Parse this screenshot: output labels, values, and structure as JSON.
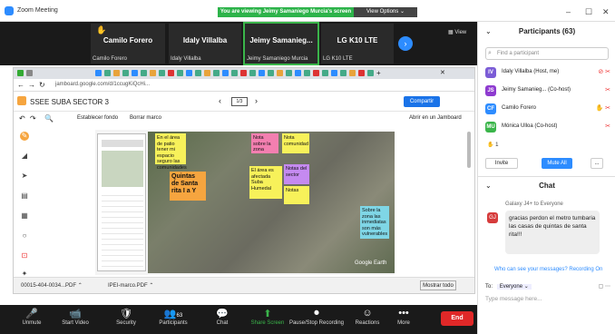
{
  "window": {
    "title": "Zoom Meeting",
    "viewing_banner": "You are viewing Jeimy Samaniego Murcia's screen",
    "view_options": "View Options ⌄"
  },
  "strip": {
    "view_label": "▦ View",
    "tiles": [
      {
        "name": "Camilo Forero",
        "sub": "Camilo Forero"
      },
      {
        "name": "Idaly Villalba",
        "sub": "Idaly Villalba"
      },
      {
        "name": "Jeimy Samanieg...",
        "sub": "Jeimy Samaniego Murcia"
      },
      {
        "name": "LG K10 LTE",
        "sub": "LG K10 LTE"
      }
    ]
  },
  "browser": {
    "url": "jamboard.google.com/d/1ccugKiQcHi...",
    "jam_title": "SSEE SUBA SECTOR 3",
    "page_indicator": "1/3",
    "share_label": "Compartir",
    "tool_labels": {
      "set_bg": "Establecer fondo",
      "clear": "Borrar marco",
      "open": "Abrir en un Jamboard"
    },
    "notes": [
      {
        "text": "En el área de patio tener mi espacio seguro las comunidades",
        "color": "#f7f15a"
      },
      {
        "text": "Quintas de Santa rita I a Y",
        "color": "#f6a53f"
      },
      {
        "text": "Nota sobre la zona",
        "color": "#f37fb0"
      },
      {
        "text": "Nota comunidad",
        "color": "#f7f15a"
      },
      {
        "text": "El área es afectada Suba Humedal",
        "color": "#f7f15a"
      },
      {
        "text": "Notas del sector",
        "color": "#c58af0"
      },
      {
        "text": "Notas",
        "color": "#f7f15a"
      },
      {
        "text": "Sobre la zona las inmediatas son más vulnerables",
        "color": "#7fd6e6"
      }
    ],
    "map_label": "Google Earth",
    "downloads": [
      "00015-404-0034...PDF ⌃",
      "IPEI-marco.PDF ⌃"
    ],
    "show_all": "Mostrar todo"
  },
  "toolbar": {
    "items": [
      {
        "icon": "🎤",
        "label": "Unmute"
      },
      {
        "icon": "📹",
        "label": "Start Video"
      },
      {
        "icon": "🛡",
        "label": "Security"
      },
      {
        "icon": "👥",
        "label": "Participants"
      },
      {
        "icon": "💬",
        "label": "Chat"
      },
      {
        "icon": "⬆",
        "label": "Share Screen"
      },
      {
        "icon": "⏺",
        "label": "Pause/Stop Recording"
      },
      {
        "icon": "☺",
        "label": "Reactions"
      },
      {
        "icon": "•••",
        "label": "More"
      }
    ],
    "participant_count": "63",
    "end_label": "End"
  },
  "panel": {
    "title": "Participants (63)",
    "search_placeholder": "Find a participant",
    "participants": [
      {
        "initials": "IV",
        "name": "Idaly Villalba (Host, me)",
        "color": "#7b5cd6"
      },
      {
        "initials": "JS",
        "name": "Jeimy Samanieg... (Co-host)",
        "color": "#8e3bd0"
      },
      {
        "initials": "CF",
        "name": "Camilo Forero",
        "color": "#2D8CFF"
      },
      {
        "initials": "MU",
        "name": "Mónica Ulloa (Co-host)",
        "color": "#3ab54a"
      }
    ],
    "raised_hands": "✋ 1",
    "invite": "Invite",
    "mute_all": "Mute All",
    "more": "...",
    "chat_title": "Chat",
    "chat_from": "Galaxy J4+ to Everyone",
    "chat_initials": "GJ",
    "chat_message": "gracias perdon el metro tumbaria las casas de quintas de santa rita!!!",
    "who_can_see": "Who can see your messages? Recording On",
    "to_label": "To:",
    "to_value": "Everyone ⌄",
    "message_placeholder": "Type message here..."
  }
}
